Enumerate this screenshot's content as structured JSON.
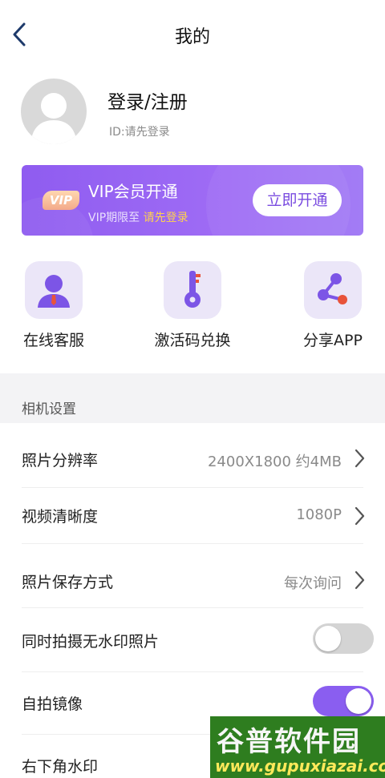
{
  "header": {
    "title": "我的",
    "back_icon": "chevron-left-icon"
  },
  "profile": {
    "name": "登录/注册",
    "id_text": "ID:请先登录",
    "avatar_icon": "default-avatar-icon"
  },
  "vip": {
    "badge": "VIP",
    "title": "VIP会员开通",
    "expire_prefix": "VIP期限至",
    "expire_value": "请先登录",
    "button": "立即开通",
    "accent": "#8f5cf0",
    "highlight": "#ffd24d"
  },
  "quick_actions": [
    {
      "label": "在线客服",
      "icon": "customer-service-icon"
    },
    {
      "label": "激活码兑换",
      "icon": "key-icon"
    },
    {
      "label": "分享APP",
      "icon": "share-icon"
    }
  ],
  "section": {
    "title": "相机设置"
  },
  "settings": [
    {
      "label": "照片分辨率",
      "value": "2400X1800 约4MB"
    },
    {
      "label": "视频清晰度",
      "value": "1080P"
    },
    {
      "label": "照片保存方式",
      "value": "每次询问"
    },
    {
      "label": "同时拍摄无水印照片",
      "toggle": "off"
    },
    {
      "label": "自拍镜像",
      "toggle": "on"
    },
    {
      "label": "右下角水印"
    }
  ],
  "watermark": {
    "main": "谷普软件园",
    "url": "www.gupuxiazai.com"
  },
  "colors": {
    "toggle_on": "#8a5ef0",
    "toggle_off": "#d4d4d4",
    "icon_bg": "#ebe6f8"
  }
}
